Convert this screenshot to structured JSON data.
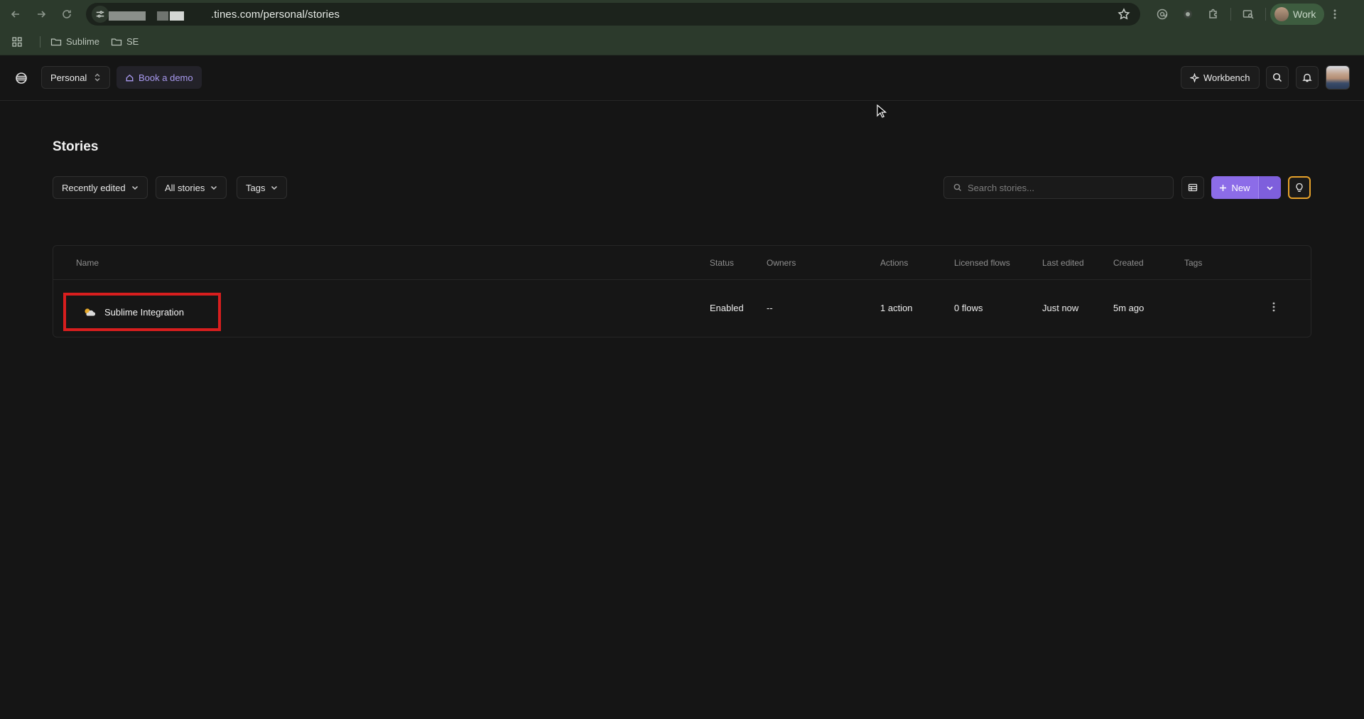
{
  "browser": {
    "url": ".tines.com/personal/stories",
    "profile_label": "Work",
    "bookmarks": [
      {
        "label": "Sublime"
      },
      {
        "label": "SE"
      }
    ]
  },
  "header": {
    "workspace": "Personal",
    "book_demo": "Book a demo",
    "workbench": "Workbench"
  },
  "page": {
    "title": "Stories",
    "filters": {
      "sort": "Recently edited",
      "scope": "All stories",
      "tags": "Tags"
    },
    "search_placeholder": "Search stories...",
    "new_label": "New"
  },
  "table": {
    "headers": {
      "name": "Name",
      "status": "Status",
      "owners": "Owners",
      "actions": "Actions",
      "licensed_flows": "Licensed flows",
      "last_edited": "Last edited",
      "created": "Created",
      "tags": "Tags"
    },
    "rows": [
      {
        "name": "Sublime Integration",
        "status": "Enabled",
        "owners": "--",
        "actions": "1 action",
        "licensed_flows": "0 flows",
        "last_edited": "Just now",
        "created": "5m ago",
        "tags": ""
      }
    ]
  },
  "colors": {
    "accent": "#8c6ce8",
    "highlight_box": "#d81e1e",
    "tip_outline": "#e6a12a",
    "browser_frame": "#2c3a2c"
  }
}
